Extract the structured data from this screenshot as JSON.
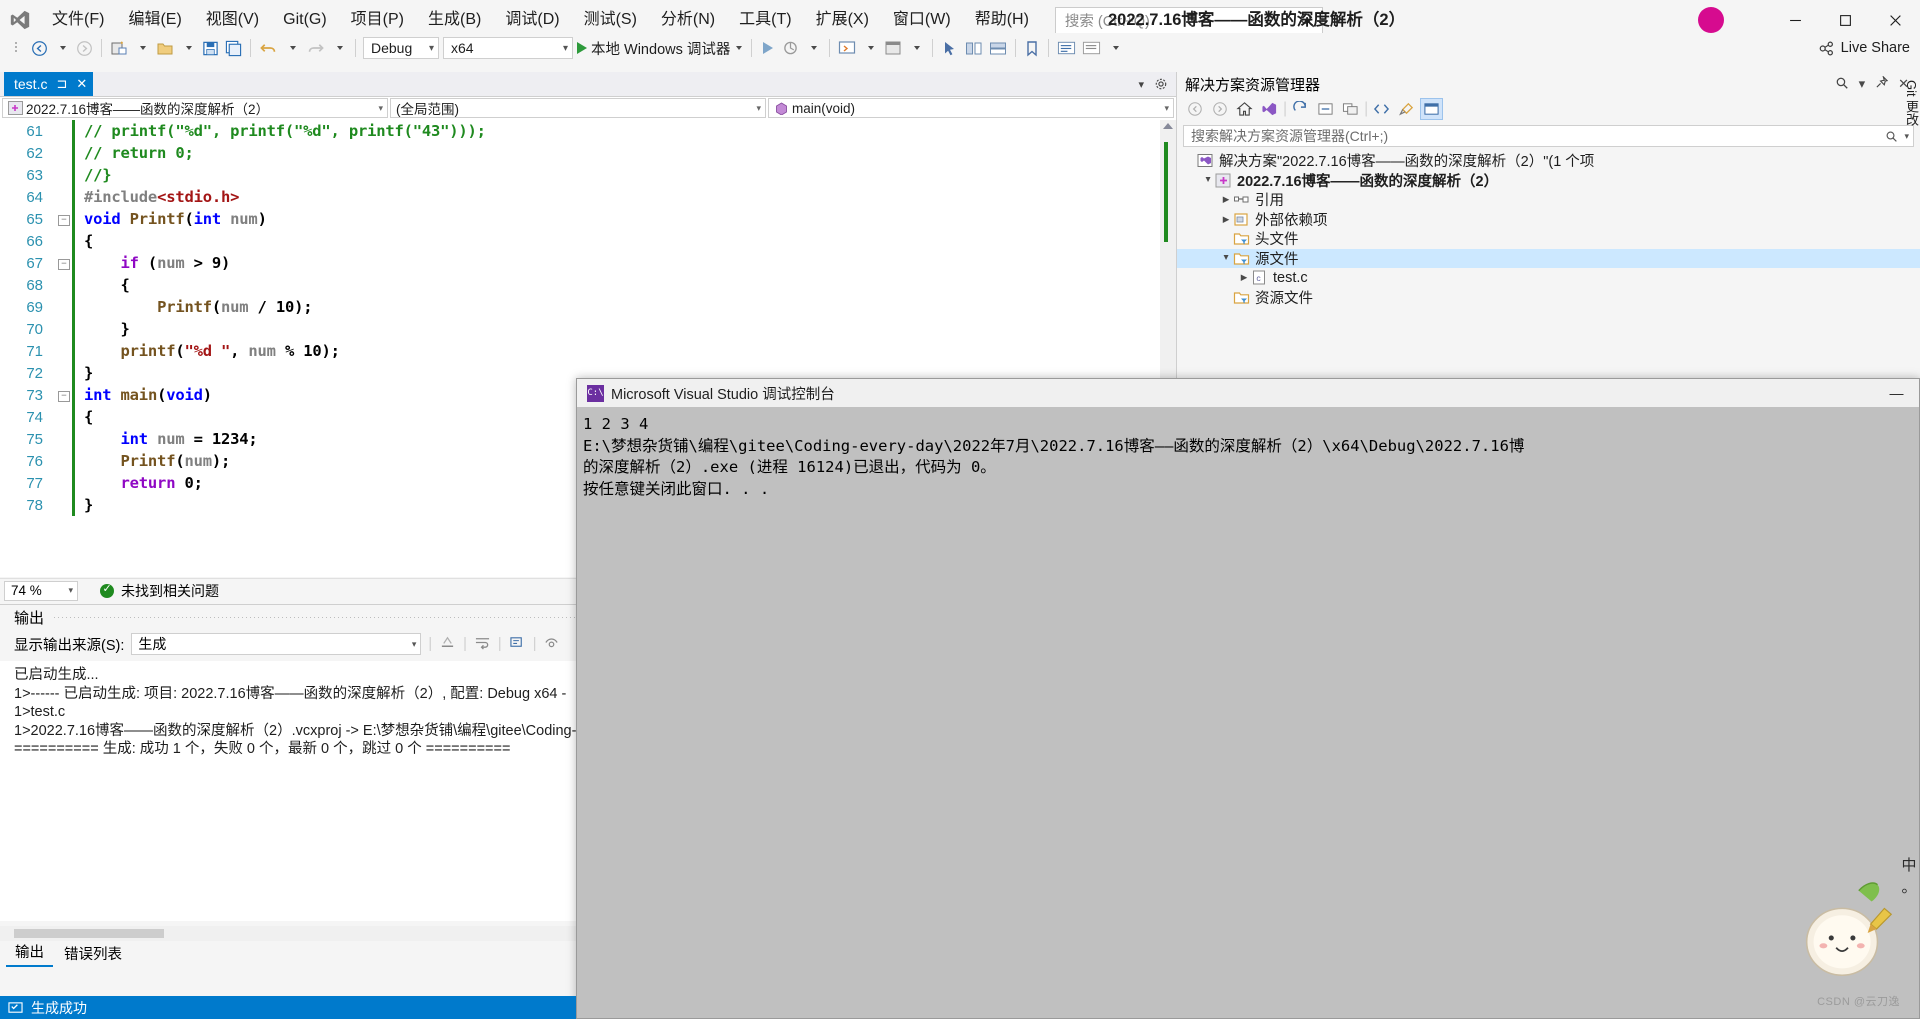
{
  "window": {
    "title": "2022.7.16博客——函数的深度解析（2）",
    "minimize": "—",
    "maximize": "▢",
    "close": "✕"
  },
  "menubar": {
    "items": [
      {
        "label": "文件(F)",
        "name": "menu-file"
      },
      {
        "label": "编辑(E)",
        "name": "menu-edit"
      },
      {
        "label": "视图(V)",
        "name": "menu-view"
      },
      {
        "label": "Git(G)",
        "name": "menu-git"
      },
      {
        "label": "项目(P)",
        "name": "menu-project"
      },
      {
        "label": "生成(B)",
        "name": "menu-build"
      },
      {
        "label": "调试(D)",
        "name": "menu-debug"
      },
      {
        "label": "测试(S)",
        "name": "menu-test"
      },
      {
        "label": "分析(N)",
        "name": "menu-analyze"
      },
      {
        "label": "工具(T)",
        "name": "menu-tools"
      },
      {
        "label": "扩展(X)",
        "name": "menu-extensions"
      },
      {
        "label": "窗口(W)",
        "name": "menu-window"
      },
      {
        "label": "帮助(H)",
        "name": "menu-help"
      }
    ]
  },
  "search": {
    "placeholder": "搜索 (Ctrl+Q)"
  },
  "toolbar": {
    "config": "Debug",
    "platform": "x64",
    "run_label": "本地 Windows 调试器",
    "live_share": "Live Share"
  },
  "editor": {
    "tab": {
      "label": "test.c",
      "pin": "⊐",
      "close": "✕"
    },
    "nav": {
      "project": "2022.7.16博客——函数的深度解析（2）",
      "scope": "(全局范围)",
      "member": "main(void)"
    },
    "lines": [
      {
        "n": "61",
        "fold": "",
        "seg": [
          {
            "t": "// printf(\"%d\", printf(\"%d\", printf(\"43\")));",
            "c": "c-com"
          }
        ]
      },
      {
        "n": "62",
        "fold": "",
        "seg": [
          {
            "t": "// return 0;",
            "c": "c-com"
          }
        ]
      },
      {
        "n": "63",
        "fold": "",
        "seg": [
          {
            "t": "//}",
            "c": "c-com"
          }
        ]
      },
      {
        "n": "64",
        "fold": "",
        "seg": [
          {
            "t": "#include",
            "c": "c-pre"
          },
          {
            "t": "<stdio.h>",
            "c": "c-inc"
          }
        ]
      },
      {
        "n": "65",
        "fold": "-",
        "seg": [
          {
            "t": "void",
            "c": "c-kw"
          },
          {
            "t": " ",
            "c": "c-pl"
          },
          {
            "t": "Printf",
            "c": "c-fn"
          },
          {
            "t": "(",
            "c": "c-pl"
          },
          {
            "t": "int",
            "c": "c-kw"
          },
          {
            "t": " ",
            "c": "c-pl"
          },
          {
            "t": "num",
            "c": "c-var"
          },
          {
            "t": ")",
            "c": "c-pl"
          }
        ]
      },
      {
        "n": "66",
        "fold": "",
        "seg": [
          {
            "t": "{",
            "c": "c-pl"
          }
        ]
      },
      {
        "n": "67",
        "fold": "-",
        "seg": [
          {
            "t": "    ",
            "c": "c-pl"
          },
          {
            "t": "if",
            "c": "c-kw2"
          },
          {
            "t": " (",
            "c": "c-pl"
          },
          {
            "t": "num",
            "c": "c-var"
          },
          {
            "t": " > ",
            "c": "c-pl"
          },
          {
            "t": "9",
            "c": "c-pl"
          },
          {
            "t": ")",
            "c": "c-pl"
          }
        ]
      },
      {
        "n": "68",
        "fold": "",
        "seg": [
          {
            "t": "    {",
            "c": "c-pl"
          }
        ]
      },
      {
        "n": "69",
        "fold": "",
        "seg": [
          {
            "t": "        ",
            "c": "c-pl"
          },
          {
            "t": "Printf",
            "c": "c-fn"
          },
          {
            "t": "(",
            "c": "c-pl"
          },
          {
            "t": "num",
            "c": "c-var"
          },
          {
            "t": " / ",
            "c": "c-pl"
          },
          {
            "t": "10);",
            "c": "c-pl"
          }
        ]
      },
      {
        "n": "70",
        "fold": "",
        "seg": [
          {
            "t": "    }",
            "c": "c-pl"
          }
        ]
      },
      {
        "n": "71",
        "fold": "",
        "seg": [
          {
            "t": "    ",
            "c": "c-pl"
          },
          {
            "t": "printf",
            "c": "c-fn"
          },
          {
            "t": "(",
            "c": "c-pl"
          },
          {
            "t": "\"%d \"",
            "c": "c-str"
          },
          {
            "t": ", ",
            "c": "c-pl"
          },
          {
            "t": "num",
            "c": "c-var"
          },
          {
            "t": " % ",
            "c": "c-pl"
          },
          {
            "t": "10);",
            "c": "c-pl"
          }
        ]
      },
      {
        "n": "72",
        "fold": "",
        "seg": [
          {
            "t": "}",
            "c": "c-pl"
          }
        ]
      },
      {
        "n": "73",
        "fold": "-",
        "seg": [
          {
            "t": "int",
            "c": "c-kw"
          },
          {
            "t": " ",
            "c": "c-pl"
          },
          {
            "t": "main",
            "c": "c-fn"
          },
          {
            "t": "(",
            "c": "c-pl"
          },
          {
            "t": "void",
            "c": "c-kw"
          },
          {
            "t": ")",
            "c": "c-pl"
          }
        ]
      },
      {
        "n": "74",
        "fold": "",
        "seg": [
          {
            "t": "{",
            "c": "c-pl"
          }
        ]
      },
      {
        "n": "75",
        "fold": "",
        "seg": [
          {
            "t": "    ",
            "c": "c-pl"
          },
          {
            "t": "int",
            "c": "c-kw"
          },
          {
            "t": " ",
            "c": "c-pl"
          },
          {
            "t": "num",
            "c": "c-var"
          },
          {
            "t": " = ",
            "c": "c-pl"
          },
          {
            "t": "1234;",
            "c": "c-pl"
          }
        ]
      },
      {
        "n": "76",
        "fold": "",
        "seg": [
          {
            "t": "    ",
            "c": "c-pl"
          },
          {
            "t": "Printf",
            "c": "c-fn"
          },
          {
            "t": "(",
            "c": "c-pl"
          },
          {
            "t": "num",
            "c": "c-var"
          },
          {
            "t": ");",
            "c": "c-pl"
          }
        ]
      },
      {
        "n": "77",
        "fold": "",
        "seg": [
          {
            "t": "    ",
            "c": "c-pl"
          },
          {
            "t": "return",
            "c": "c-kw2"
          },
          {
            "t": " 0;",
            "c": "c-pl"
          }
        ]
      },
      {
        "n": "78",
        "fold": "",
        "seg": [
          {
            "t": "}",
            "c": "c-pl"
          }
        ]
      }
    ],
    "zoom": "74 %",
    "issues": "未找到相关问题"
  },
  "output": {
    "title": "输出",
    "source_label": "显示输出来源(S):",
    "source_value": "生成",
    "text": "已启动生成...\n1>------ 已启动生成: 项目: 2022.7.16博客——函数的深度解析（2）, 配置: Debug x64 -\n1>test.c\n1>2022.7.16博客——函数的深度解析（2）.vcxproj -> E:\\梦想杂货铺\\编程\\gitee\\Coding-\n========== 生成: 成功 1 个，失败 0 个，最新 0 个，跳过 0 个 ==========",
    "tabs": [
      {
        "label": "输出",
        "selected": true
      },
      {
        "label": "错误列表",
        "selected": false
      }
    ]
  },
  "solution_explorer": {
    "title": "解决方案资源管理器",
    "search_placeholder": "搜索解决方案资源管理器(Ctrl+;)",
    "tree": [
      {
        "indent": 0,
        "arrow": "",
        "icon": "solution-icon",
        "label": "解决方案\"2022.7.16博客——函数的深度解析（2）\"(1 个项",
        "bold": false,
        "selected": false
      },
      {
        "indent": 1,
        "arrow": "▲",
        "icon": "project-icon",
        "label": "2022.7.16博客——函数的深度解析（2）",
        "bold": true,
        "selected": false
      },
      {
        "indent": 2,
        "arrow": "▶",
        "icon": "references-icon",
        "label": "引用",
        "bold": false,
        "selected": false
      },
      {
        "indent": 2,
        "arrow": "▶",
        "icon": "external-deps-icon",
        "label": "外部依赖项",
        "bold": false,
        "selected": false
      },
      {
        "indent": 2,
        "arrow": "",
        "icon": "folder-filter-icon",
        "label": "头文件",
        "bold": false,
        "selected": false
      },
      {
        "indent": 2,
        "arrow": "▲",
        "icon": "folder-filter-icon",
        "label": "源文件",
        "bold": false,
        "selected": true
      },
      {
        "indent": 3,
        "arrow": "▶",
        "icon": "c-file-icon",
        "label": "test.c",
        "bold": false,
        "selected": false
      },
      {
        "indent": 2,
        "arrow": "",
        "icon": "folder-filter-icon",
        "label": "资源文件",
        "bold": false,
        "selected": false
      }
    ]
  },
  "git_changes_label": "Git 更改",
  "console": {
    "title": "Microsoft Visual Studio 调试控制台",
    "minimize": "—",
    "text": "1 2 3 4\nE:\\梦想杂货铺\\编程\\gitee\\Coding-every-day\\2022年7月\\2022.7.16博客——函数的深度解析（2）\\x64\\Debug\\2022.7.16博\n的深度解析（2）.exe (进程 16124)已退出，代码为 0。\n按任意键关闭此窗口. . ."
  },
  "status_bar": {
    "text": "生成成功"
  },
  "watermark": "CSDN @云刀逸",
  "ime_label": "中"
}
